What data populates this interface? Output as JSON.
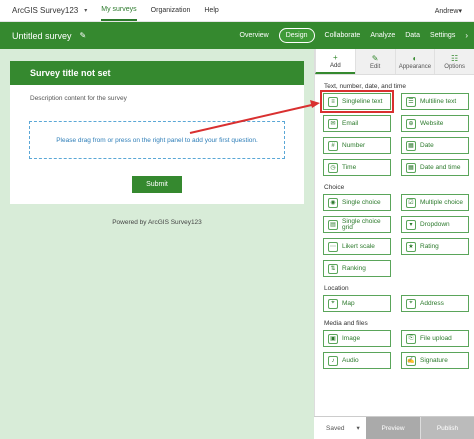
{
  "topbar": {
    "brand": "ArcGIS Survey123",
    "nav": [
      "My surveys",
      "Organization",
      "Help"
    ],
    "user": "Andrew"
  },
  "greenbar": {
    "title": "Untitled survey",
    "tabs": [
      "Overview",
      "Design",
      "Collaborate",
      "Analyze",
      "Data",
      "Settings"
    ]
  },
  "form": {
    "title": "Survey title not set",
    "description": "Description content for the survey",
    "drop_hint": "Please drag from or press on the right panel to add your first question.",
    "submit": "Submit",
    "powered": "Powered by ArcGIS Survey123"
  },
  "panel": {
    "tabs": [
      "Add",
      "Edit",
      "Appearance",
      "Options"
    ],
    "sections": [
      {
        "title": "Text, number, date, and time",
        "items": [
          "Singleline text",
          "Multiline text",
          "Email",
          "Website",
          "Number",
          "Date",
          "Time",
          "Date and time"
        ]
      },
      {
        "title": "Choice",
        "items": [
          "Single choice",
          "Multiple choice",
          "Single choice grid",
          "Dropdown",
          "Likert scale",
          "Rating",
          "Ranking"
        ]
      },
      {
        "title": "Location",
        "items": [
          "Map",
          "Address"
        ]
      },
      {
        "title": "Media and files",
        "items": [
          "Image",
          "File upload",
          "Audio",
          "Signature"
        ]
      }
    ]
  },
  "footer": {
    "saved": "Saved",
    "preview": "Preview",
    "publish": "Publish"
  },
  "colors": {
    "brand_green": "#35892f",
    "canvas_bg": "#d8ecd8",
    "highlight": "#d93030"
  }
}
